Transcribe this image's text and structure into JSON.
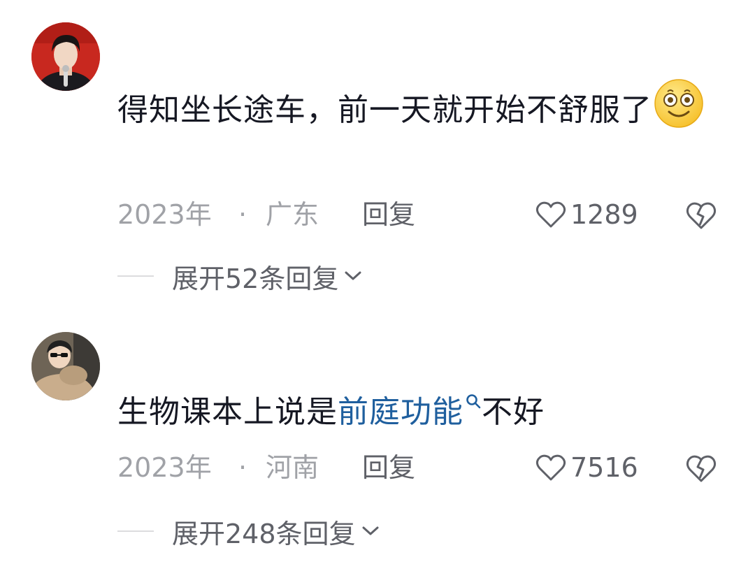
{
  "comments": [
    {
      "avatar_icon": "user-avatar-red-background",
      "text": "得知坐长途车，前一天就开始不舒服了",
      "emoji_icon": "dizzy-face-emoji",
      "year": "2023年",
      "separator": "·",
      "location": "广东",
      "reply_label": "回复",
      "like_icon": "heart-outline-icon",
      "likes": "1289",
      "dislike_icon": "broken-heart-icon",
      "expand_label": "展开52条回复",
      "expand_icon": "chevron-down-icon"
    },
    {
      "avatar_icon": "user-avatar-photo",
      "text_before_link": "生物课本上说是",
      "link_text": "前庭功能",
      "link_icon": "search-icon",
      "text_after_link": "不好",
      "year": "2023年",
      "separator": "·",
      "location": "河南",
      "reply_label": "回复",
      "like_icon": "heart-outline-icon",
      "likes": "7516",
      "dislike_icon": "broken-heart-icon",
      "expand_label": "展开248条回复",
      "expand_icon": "chevron-down-icon"
    }
  ],
  "colors": {
    "text_primary": "#161823",
    "text_secondary": "#a0a2a7",
    "text_action": "#5f6168",
    "link": "#1f5f9e"
  }
}
